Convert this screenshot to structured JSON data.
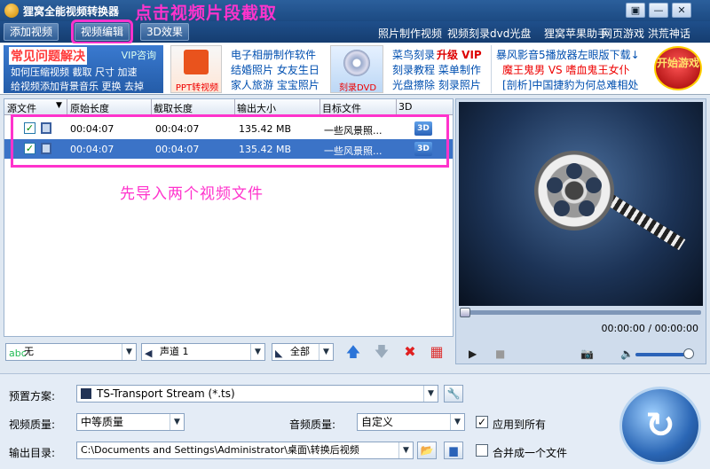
{
  "window": {
    "title": "狸窝全能视频转换器",
    "menu_label": "▣",
    "minimize_label": "—",
    "close_label": "✕"
  },
  "annotations": {
    "top": "点击视频片段截取",
    "middle": "先导入两个视频文件"
  },
  "toolbar": {
    "add_video": "添加视频",
    "edit_video": "视频编辑",
    "effect_3d": "3D效果",
    "links": [
      "照片制作视频",
      "视频刻录dvd光盘",
      "狸窝苹果助手",
      "网页游戏 洪荒神话"
    ]
  },
  "adstrip": {
    "faq_title": "常见问题解决",
    "vip_label": "VIP咨询",
    "faq_line1": "如何压缩视频  截取  尺寸  加速",
    "faq_line2": "给视频添加背景音乐  更换  去掉",
    "ppt_caption": "PPT转视频",
    "col2": [
      "电子相册制作软件",
      "结婚照片  女友生日",
      "家人旅游  宝宝照片"
    ],
    "burn_caption": "刻录DVD",
    "col3a": "菜鸟刻录",
    "col3a_vip": "升级 VIP",
    "col3b": "刻录教程  菜单制作",
    "col3c": "光盘擦除  刻录照片",
    "col4a": "暴风影音5播放器左眼版下载↓",
    "col4b": "魔王鬼男 VS 嗜血鬼王女仆",
    "col4c": "[剖析]中国捷豹为何总难相处",
    "start_game": "开始游戏"
  },
  "list": {
    "columns": [
      "源文件",
      "原始长度",
      "截取长度",
      "输出大小",
      "目标文件",
      "3D"
    ],
    "rows": [
      {
        "checked": "✓",
        "orig": "00:04:07",
        "clip": "00:04:07",
        "size": "135.42 MB",
        "target": "一些风景照...",
        "badge": "3D"
      },
      {
        "checked": "✓",
        "orig": "00:04:07",
        "clip": "00:04:07",
        "size": "135.42 MB",
        "target": "一些风景照...",
        "badge": "3D"
      }
    ]
  },
  "list_controls": {
    "subtitle": "无",
    "audio_track": "声道 1",
    "scope": "全部",
    "up_icon": "🡅",
    "down_icon": "🡇",
    "delete_icon": "✖",
    "clear_icon": "▦"
  },
  "preview": {
    "timecode": "00:00:00 / 00:00:00",
    "play_icon": "▶",
    "stop_icon": "■",
    "camera_icon": "📷",
    "volume_icon": "🔈"
  },
  "settings": {
    "preset_label": "预置方案:",
    "preset_value": "TS-Transport Stream (*.ts)",
    "video_quality_label": "视频质量:",
    "video_quality_value": "中等质量",
    "audio_quality_label": "音频质量:",
    "audio_quality_value": "自定义",
    "apply_all_label": "应用到所有",
    "apply_all_check": "✓",
    "output_dir_label": "输出目录:",
    "output_dir_value": "C:\\Documents and Settings\\Administrator\\桌面\\转换后视频",
    "merge_label": "合并成一个文件",
    "wrench_icon": "🔧",
    "folder_icon": "📂",
    "open_icon": "▆",
    "convert_icon": "↻"
  }
}
